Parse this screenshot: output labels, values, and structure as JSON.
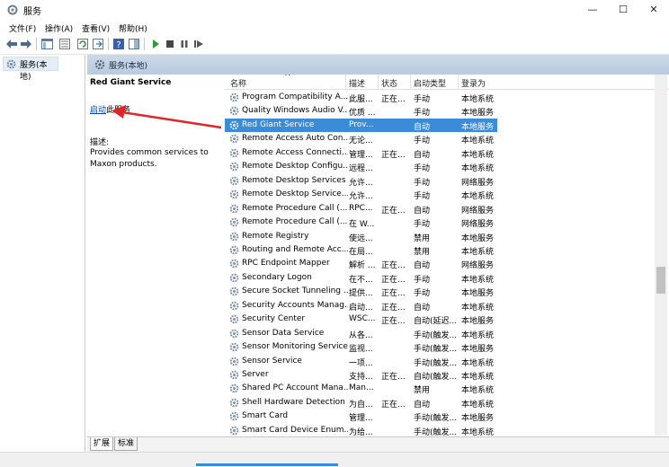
{
  "window": {
    "title": "服务"
  },
  "menu": [
    "文件(F)",
    "操作(A)",
    "查看(V)",
    "帮助(H)"
  ],
  "tree": {
    "item": "服务(本地)"
  },
  "right_header": {
    "label": "服务(本地)"
  },
  "detail": {
    "service_name": "Red Giant Service",
    "start_link": "启动",
    "start_suffix": "此服务",
    "desc_label": "描述:",
    "desc_text": "Provides common services to Maxon products."
  },
  "table": {
    "columns": [
      "名称",
      "描述",
      "状态",
      "启动类型",
      "登录为"
    ],
    "rows": [
      {
        "name": "Program Compatibility A...",
        "desc": "此服...",
        "status": "正在...",
        "start": "手动",
        "logon": "本地系统",
        "selected": false
      },
      {
        "name": "Quality Windows Audio V...",
        "desc": "优质 ...",
        "status": "",
        "start": "手动",
        "logon": "本地服务",
        "selected": false
      },
      {
        "name": "Red Giant Service",
        "desc": "Prov...",
        "status": "",
        "start": "自动",
        "logon": "本地服务",
        "selected": true
      },
      {
        "name": "Remote Access Auto Con...",
        "desc": "无论...",
        "status": "",
        "start": "手动",
        "logon": "本地系统",
        "selected": false
      },
      {
        "name": "Remote Access Connecti...",
        "desc": "管理...",
        "status": "正在...",
        "start": "自动",
        "logon": "本地系统",
        "selected": false
      },
      {
        "name": "Remote Desktop Configu...",
        "desc": "远程...",
        "status": "",
        "start": "手动",
        "logon": "本地系统",
        "selected": false
      },
      {
        "name": "Remote Desktop Services",
        "desc": "允许...",
        "status": "",
        "start": "手动",
        "logon": "网络服务",
        "selected": false
      },
      {
        "name": "Remote Desktop Service...",
        "desc": "允许...",
        "status": "",
        "start": "手动",
        "logon": "本地系统",
        "selected": false
      },
      {
        "name": "Remote Procedure Call (...",
        "desc": "RPC...",
        "status": "正在...",
        "start": "自动",
        "logon": "网络服务",
        "selected": false
      },
      {
        "name": "Remote Procedure Call (...",
        "desc": "在 W...",
        "status": "",
        "start": "手动",
        "logon": "网络服务",
        "selected": false
      },
      {
        "name": "Remote Registry",
        "desc": "使远...",
        "status": "",
        "start": "禁用",
        "logon": "本地服务",
        "selected": false
      },
      {
        "name": "Routing and Remote Acc...",
        "desc": "在局...",
        "status": "",
        "start": "禁用",
        "logon": "本地系统",
        "selected": false
      },
      {
        "name": "RPC Endpoint Mapper",
        "desc": "解析 ...",
        "status": "正在...",
        "start": "自动",
        "logon": "网络服务",
        "selected": false
      },
      {
        "name": "Secondary Logon",
        "desc": "在不...",
        "status": "正在...",
        "start": "手动",
        "logon": "本地系统",
        "selected": false
      },
      {
        "name": "Secure Socket Tunneling ...",
        "desc": "提供...",
        "status": "正在...",
        "start": "手动",
        "logon": "本地服务",
        "selected": false
      },
      {
        "name": "Security Accounts Manag...",
        "desc": "启动...",
        "status": "正在...",
        "start": "自动",
        "logon": "本地系统",
        "selected": false
      },
      {
        "name": "Security Center",
        "desc": "WSC...",
        "status": "正在...",
        "start": "自动(延迟...",
        "logon": "本地服务",
        "selected": false
      },
      {
        "name": "Sensor Data Service",
        "desc": "从各...",
        "status": "",
        "start": "手动(触发...",
        "logon": "本地系统",
        "selected": false
      },
      {
        "name": "Sensor Monitoring Service",
        "desc": "监视...",
        "status": "",
        "start": "手动(触发...",
        "logon": "本地服务",
        "selected": false
      },
      {
        "name": "Sensor Service",
        "desc": "一项...",
        "status": "",
        "start": "手动(触发...",
        "logon": "本地系统",
        "selected": false
      },
      {
        "name": "Server",
        "desc": "支持...",
        "status": "正在...",
        "start": "自动(触发...",
        "logon": "本地系统",
        "selected": false
      },
      {
        "name": "Shared PC Account Mana...",
        "desc": "Man...",
        "status": "",
        "start": "禁用",
        "logon": "本地系统",
        "selected": false
      },
      {
        "name": "Shell Hardware Detection",
        "desc": "为自...",
        "status": "正在...",
        "start": "自动",
        "logon": "本地系统",
        "selected": false
      },
      {
        "name": "Smart Card",
        "desc": "管理...",
        "status": "",
        "start": "手动(触发...",
        "logon": "本地服务",
        "selected": false
      },
      {
        "name": "Smart Card Device Enum...",
        "desc": "为给...",
        "status": "",
        "start": "手动(触发...",
        "logon": "本地系统",
        "selected": false
      }
    ]
  },
  "tabs": [
    "扩展",
    "标准"
  ],
  "colors": {
    "selection": "#3b8bd8",
    "link": "#0645ad",
    "arrow": "#e0262b",
    "header": "#c4d4e6"
  }
}
